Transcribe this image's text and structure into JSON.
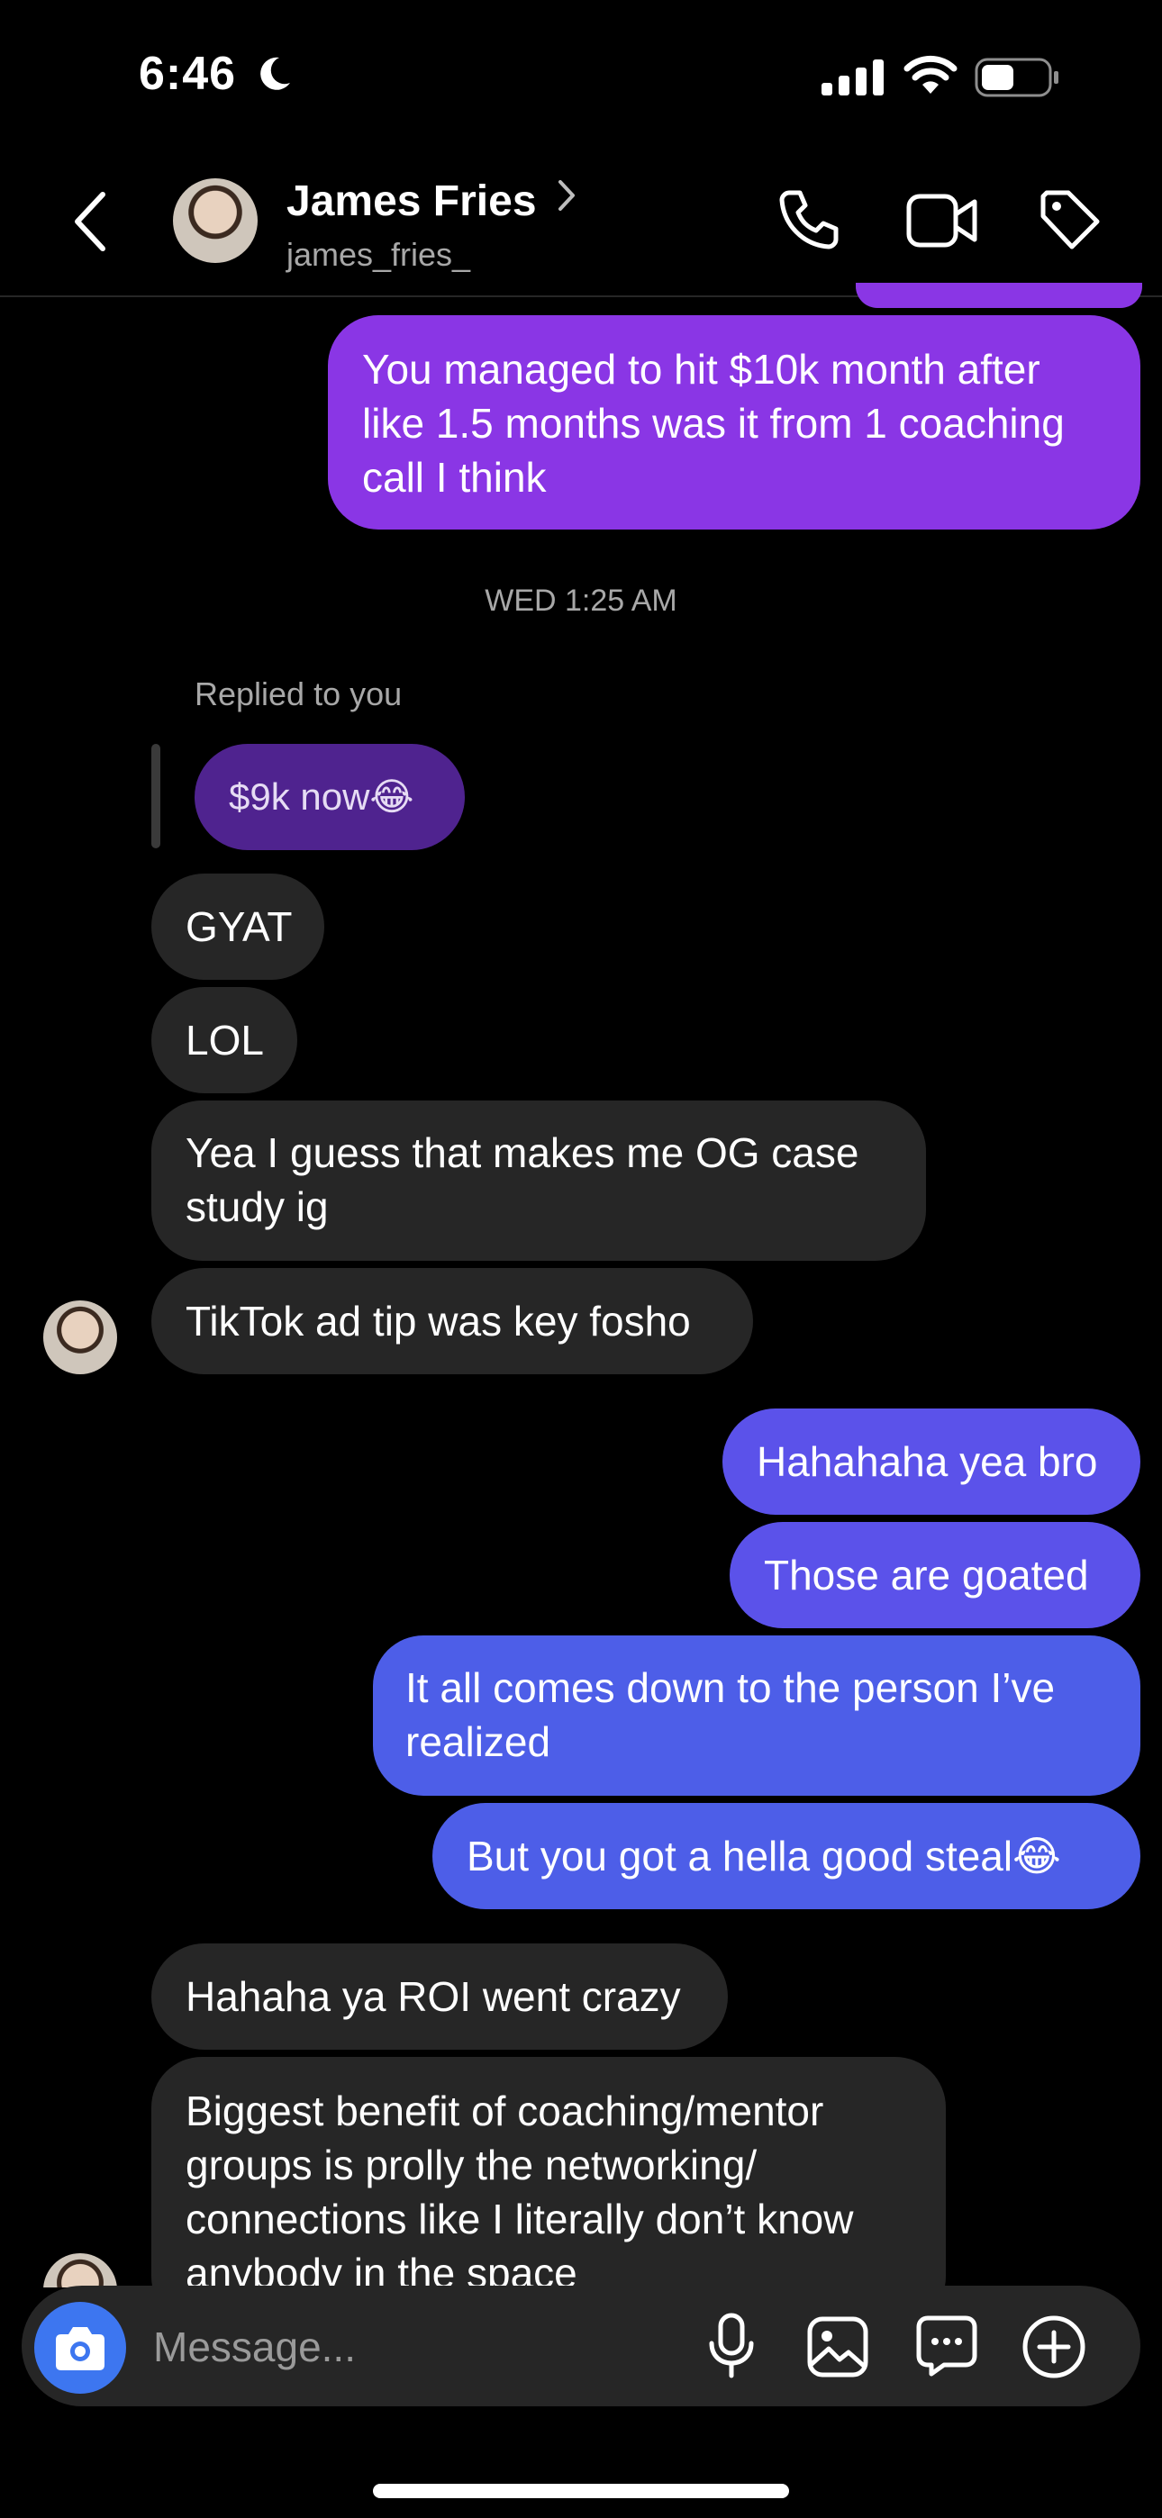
{
  "status_bar": {
    "time": "6:46",
    "battery_level": 0.5
  },
  "header": {
    "name": "James Fries",
    "username": "james_fries_"
  },
  "timestamp": "WED 1:25 AM",
  "reply": {
    "context_label": "Replied to you",
    "quoted_text": "$9k now😂"
  },
  "messages": [
    {
      "sender": "me",
      "text": "You managed to hit $10k month after like 1.5 months was it from 1 coaching call I think"
    },
    {
      "sender": "them",
      "text": "GYAT"
    },
    {
      "sender": "them",
      "text": "LOL"
    },
    {
      "sender": "them",
      "text": "Yea I guess that makes me OG case study ig"
    },
    {
      "sender": "them",
      "text": "TikTok ad tip was key fosho"
    },
    {
      "sender": "me",
      "text": "Hahahaha yea bro"
    },
    {
      "sender": "me",
      "text": "Those are goated"
    },
    {
      "sender": "me",
      "text": "It all comes down to the person I’ve realized"
    },
    {
      "sender": "me",
      "text": "But you got a hella good steal😂"
    },
    {
      "sender": "them",
      "text": "Hahaha ya ROI went crazy"
    },
    {
      "sender": "them",
      "text": "Biggest benefit of coaching/mentor groups is prolly the networking/ connections like I literally don’t know anybody in the space"
    }
  ],
  "composer": {
    "placeholder": "Message...",
    "icons": [
      "camera-icon",
      "microphone-icon",
      "gallery-icon",
      "sticker-icon",
      "plus-icon"
    ]
  },
  "colors": {
    "background": "#000000",
    "incoming_bubble": "#262626",
    "outgoing_purple": "#8a36e5",
    "outgoing_violet": "#5b52ea",
    "outgoing_blue": "#4d5ee8",
    "camera_button": "#3d76f0"
  }
}
